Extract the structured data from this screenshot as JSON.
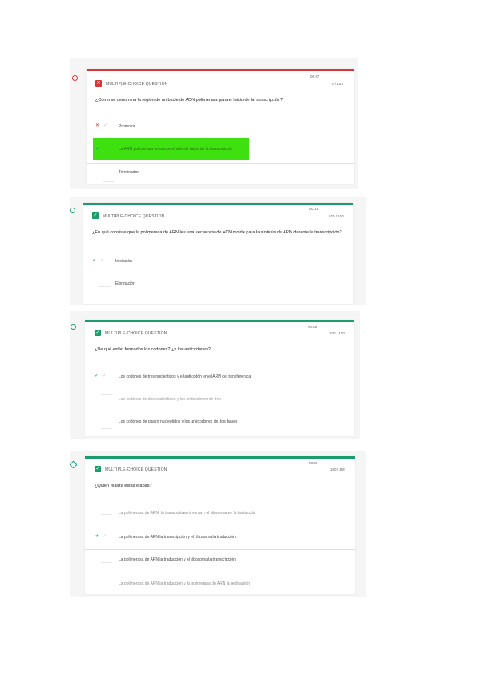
{
  "colors": {
    "red": "#d93636",
    "green": "#1a9d6b",
    "highlight": "#3ee010"
  },
  "icons": {
    "wrong": "x-icon",
    "correct": "check-icon"
  },
  "questions": [
    {
      "type": "MULTIPLE-CHOICE QUESTION",
      "status": "incorrect",
      "meta1": "00:47",
      "meta2": "0 / 100",
      "text": "¿Cómo se denomina la región de un bucle de ADN polimerasa para el inicio de la transcripción?",
      "answers": [
        "Promotor",
        "La ARN polimerasa reconoce el sitio de inicio de la transcripción",
        "Terminador"
      ]
    },
    {
      "type": "MULTIPLE-CHOICE QUESTION",
      "status": "correct",
      "meta1": "00:18",
      "meta2": "100 / 100",
      "text": "¿En qué consiste que la polimerasa de ARN lee una secuencia de ADN molde para la síntesis de ARN durante la transcripción?",
      "answers": [
        "Iniciación",
        "Elongación"
      ]
    },
    {
      "type": "MULTIPLE-CHOICE QUESTION",
      "status": "correct",
      "meta1": "00:45",
      "meta2": "100 / 100",
      "text": "¿De qué están formados los codones? ¿y los anticodones?",
      "answers": [
        "Los codones de tres nucleótidos y el anticodón en el ARN de transferencia",
        "Los codones de dos nucleótidos y los anticodones de tres",
        "Los codones de cuatro nucleótidos y los anticodones de dos bases"
      ]
    },
    {
      "type": "MULTIPLE-CHOICE QUESTION",
      "status": "correct",
      "meta1": "00:30",
      "meta2": "100 / 100",
      "text": "¿Quién realiza estas etapas?",
      "answers": [
        "La polimerasa de ARN, la transcriptasa inversa y el ribosoma en la traducción",
        "La polimerasa de ARN la transcripción y el ribosoma la traducción",
        "La polimerasa de ARN la traducción y el ribosoma la transcripción",
        "La polimerasa de ARN la traducción y la polimerasa de ARN la replicación"
      ]
    }
  ]
}
